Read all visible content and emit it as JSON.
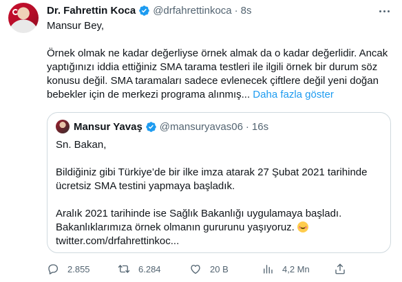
{
  "tweet": {
    "author_name": "Dr. Fahrettin Koca",
    "handle": "@drfahrettinkoca",
    "separator": "·",
    "time": "8s",
    "greeting": "Mansur Bey,",
    "text": "Örnek olmak ne kadar değerliyse örnek almak da o kadar değerlidir. Ancak yaptığınızı iddia ettiğiniz SMA tarama testleri ile ilgili örnek bir durum söz konusu değil. SMA taramaları sadece evlenecek çiftlere değil yeni doğan bebekler için de merkezi programa alınmış...",
    "show_more": "Daha fazla göster"
  },
  "quote": {
    "author_name": "Mansur Yavaş",
    "handle": "@mansuryavas06",
    "separator": "·",
    "time": "16s",
    "line1": "Sn. Bakan,",
    "line2": "Bildiğiniz gibi Türkiye’de bir ilke imza atarak 27 Şubat 2021 tarihinde ücretsiz SMA testini yapmaya başladık.",
    "line3": "Aralık 2021 tarihinde ise Sağlık Bakanlığı uygulamaya başladı. Bakanlıklarımıza örnek olmanın gururunu yaşıyoruz.",
    "link": "twitter.com/drfahrettinkoc..."
  },
  "actions": {
    "replies": "2.855",
    "retweets": "6.284",
    "likes": "20 B",
    "views": "4,2 Mn"
  },
  "colors": {
    "accent": "#1d9bf0",
    "muted": "#536471",
    "text": "#0f1419",
    "border": "#cfd9de"
  },
  "icons": [
    "verified-badge-icon",
    "more-icon",
    "reply-icon",
    "retweet-icon",
    "like-icon",
    "views-icon",
    "share-icon",
    "smiling-face-emoji"
  ]
}
